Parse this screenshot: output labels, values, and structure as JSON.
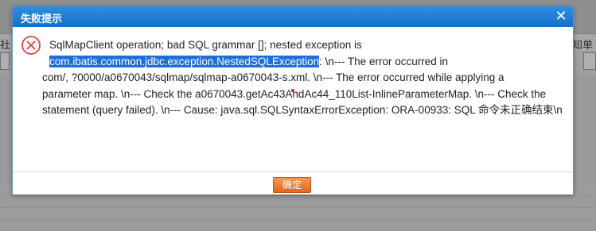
{
  "background": {
    "left_text": "社",
    "right_text": "通知单"
  },
  "dialog": {
    "title": "失败提示",
    "close_glyph": "✕",
    "icon": "error-circle-x-icon",
    "message_lines": [
      {
        "text": "SqlMapClient operation; bad SQL grammar []; nested exception is"
      },
      {
        "highlight": "com.ibatis.common.jdbc.exception.NestedSQLException",
        "text": ": \\n--- The error occurred in"
      },
      {
        "text": "com/,          ?0000/a0670043/sqlmap/sqlmap-a0670043-s.xml. \\n--- The error occurred while applying a"
      },
      {
        "text": "parameter map. \\n--- Check the a0670043.getAc43AndAc44_110List-InlineParameterMap. \\n--- Check the"
      },
      {
        "text": "statement (query failed). \\n--- Cause: java.sql.SQLSyntaxErrorException: ORA-00933: SQL 命令未正确结束\\n"
      }
    ],
    "ok_label": "确定"
  },
  "colors": {
    "titlebar": "#1f7fd6",
    "selection": "#1e6fd8",
    "ok_button": "#ec7a30",
    "error_icon": "#e04040"
  }
}
